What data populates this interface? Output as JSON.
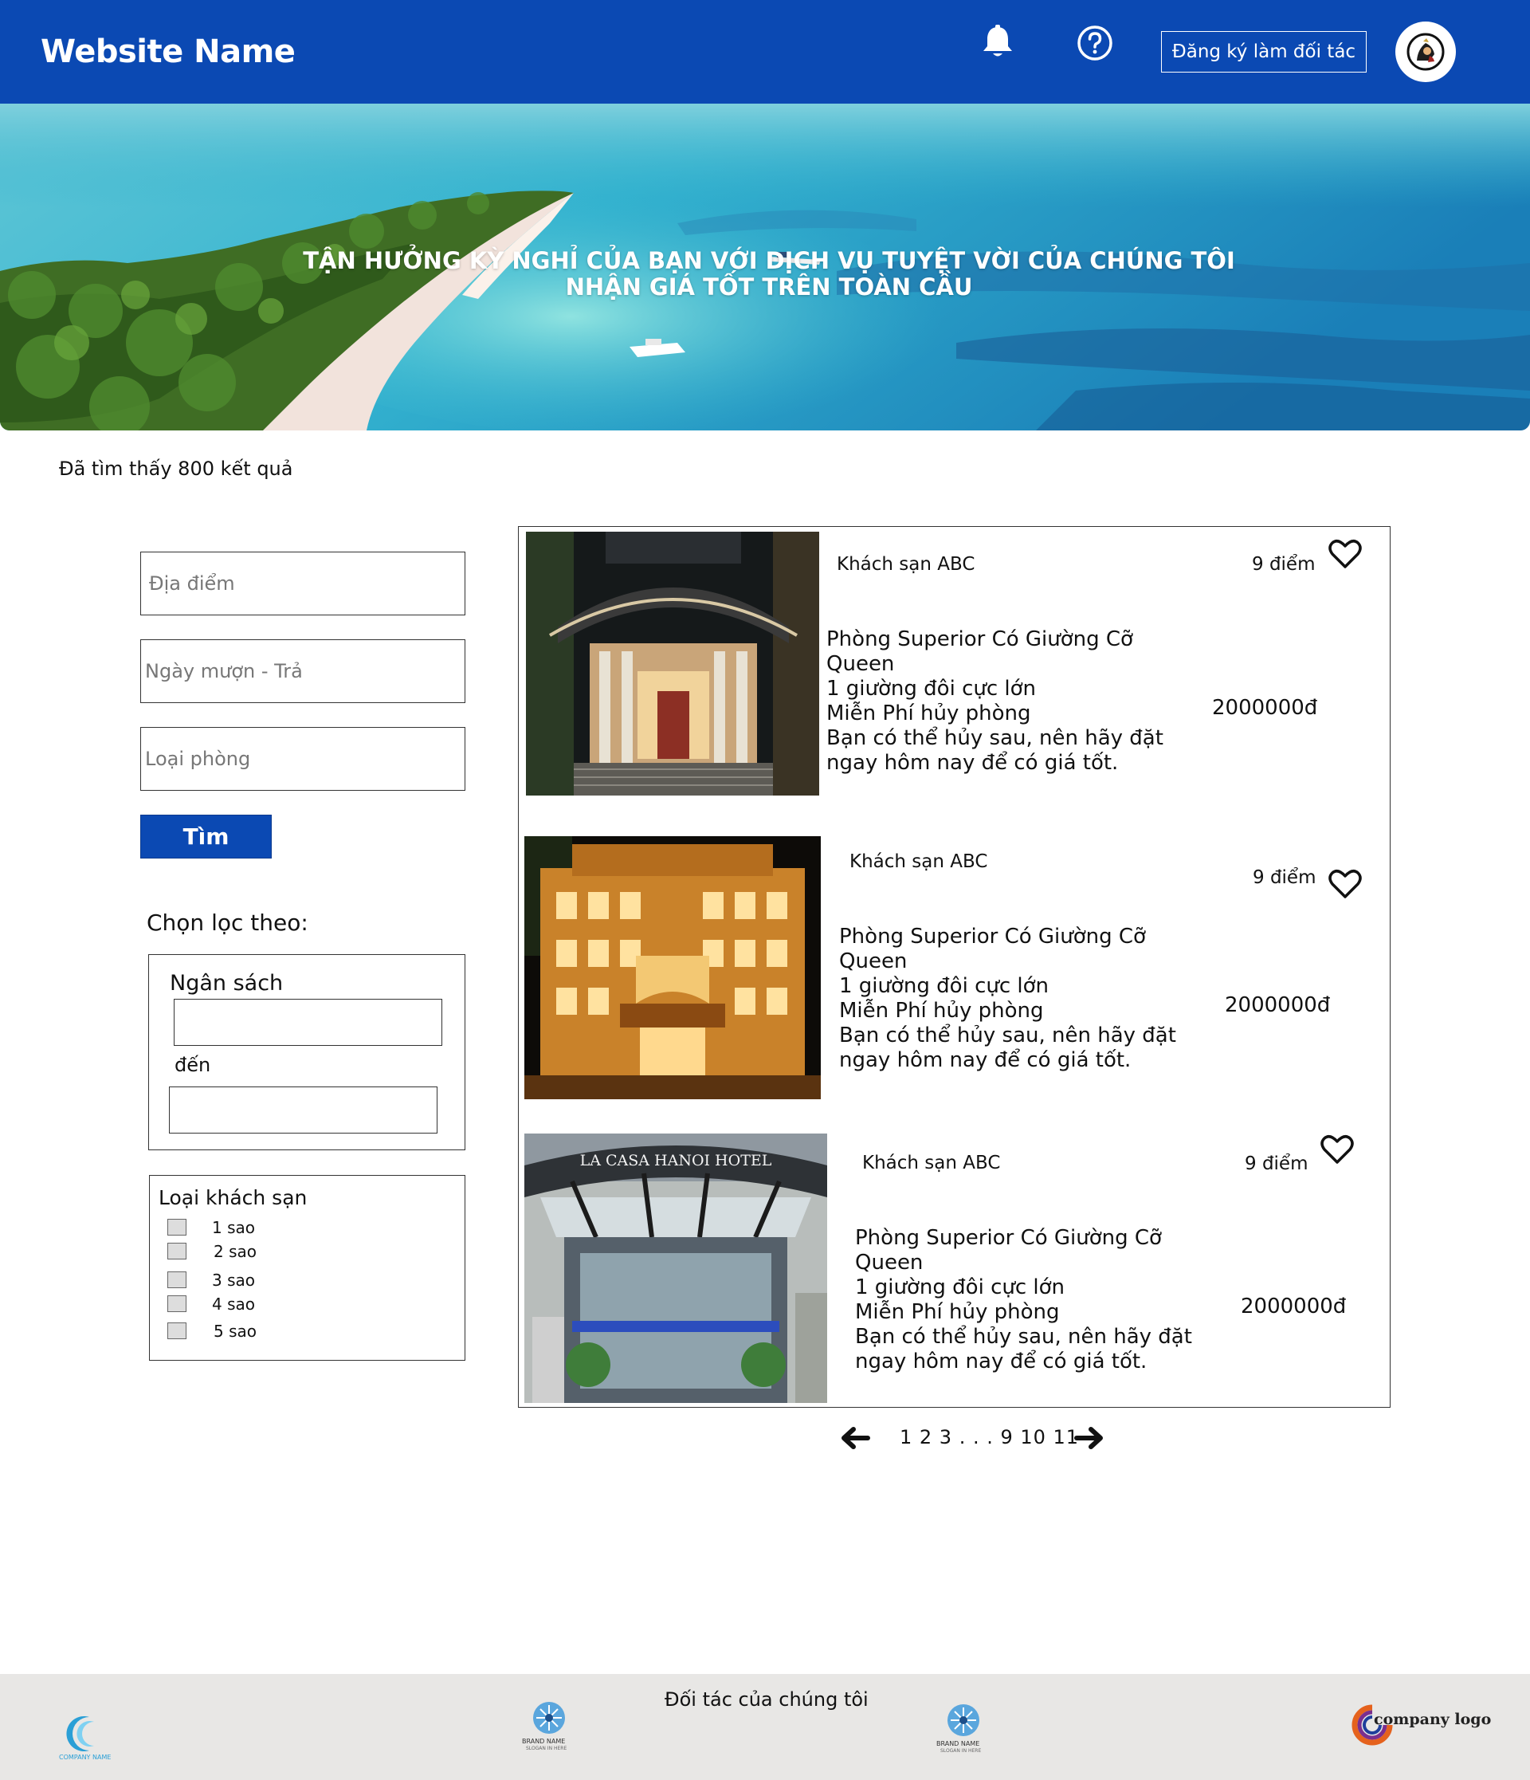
{
  "header": {
    "site_name": "Website Name",
    "partner_button": "Đăng ký làm đối tác"
  },
  "hero": {
    "line1": "TẬN HƯỞNG KỲ NGHỈ CỦA BẠN VỚI DỊCH VỤ TUYỆT VỜI CỦA CHÚNG TÔI",
    "line2": "NHẬN GIÁ TỐT TRÊN TOÀN CẦU"
  },
  "results": {
    "count_text": "Đã tìm thấy 800 kết quả"
  },
  "search": {
    "location_placeholder": "Địa điểm",
    "dates_placeholder": "Ngày mượn - Trả",
    "room_type_placeholder": "Loại phòng",
    "submit_label": "Tìm"
  },
  "filters": {
    "title": "Chọn lọc theo:",
    "budget_label": "Ngân sách",
    "to_label": "đến",
    "hotel_type_label": "Loại khách sạn",
    "stars": [
      "1 sao",
      "2 sao",
      "3 sao",
      "4 sao",
      "5 sao"
    ]
  },
  "hotels": [
    {
      "name": "Khách sạn ABC",
      "score": "9 điểm",
      "desc": [
        "Phòng Superior Có Giường Cỡ",
        "Queen",
        "1 giường đôi cực lớn",
        "Miễn Phí hủy phòng",
        "Bạn có thể hủy sau, nên hãy đặt",
        "ngay hôm nay để có giá tốt."
      ],
      "price": "2000000đ"
    },
    {
      "name": "Khách sạn ABC",
      "score": "9 điểm",
      "desc": [
        "Phòng Superior Có Giường Cỡ",
        "Queen",
        "1 giường đôi cực lớn",
        "Miễn Phí hủy phòng",
        "Bạn có thể hủy sau, nên hãy đặt",
        "ngay hôm nay để có giá tốt."
      ],
      "price": "2000000đ"
    },
    {
      "name": "Khách sạn ABC",
      "score": "9 điểm",
      "desc": [
        "Phòng Superior Có Giường Cỡ",
        "Queen",
        "1 giường đôi cực lớn",
        "Miễn Phí hủy phòng",
        "Bạn có thể hủy sau, nên hãy đặt",
        "ngay hôm nay để có giá tốt."
      ],
      "price": "2000000đ",
      "sign_text": "LA CASA HANOI HOTEL"
    }
  ],
  "pagination": {
    "pages_text": "1 2 3 . . . 9 10 11"
  },
  "footer": {
    "title": "Đối tác của chúng tôi",
    "logos": {
      "company_name": "COMPANY NAME",
      "brand_name": "BRAND NAME",
      "brand_slogan": "SLOGAN IN HERE",
      "company_logo": "company logo"
    }
  },
  "colors": {
    "brand_blue": "#0b49b3",
    "footer_bg": "#e8e7e5"
  }
}
